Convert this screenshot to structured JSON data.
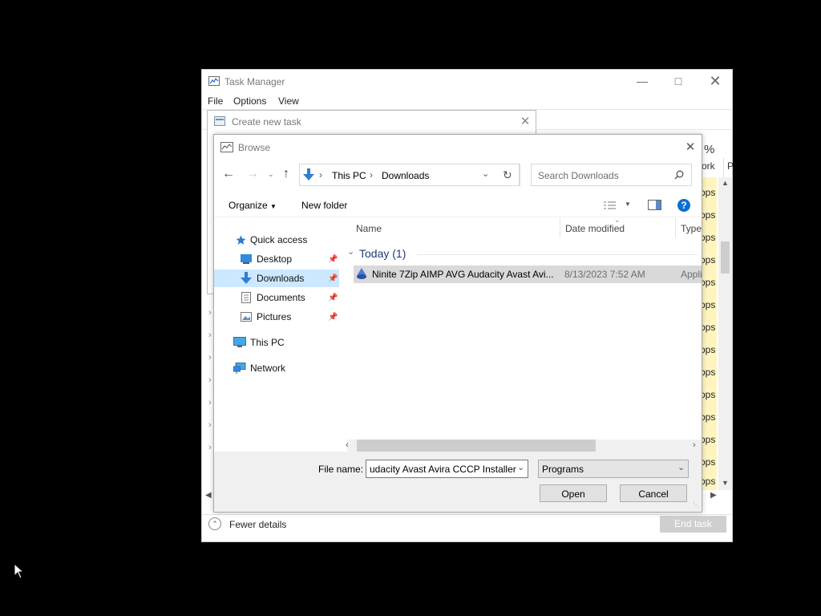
{
  "task_manager": {
    "title": "Task Manager",
    "menu": [
      "File",
      "Options",
      "View"
    ],
    "col_percent": "%",
    "col_ork": "ork",
    "col_p": "P",
    "ops_values": [
      "ops",
      "ops",
      "ops",
      "ops",
      "ops",
      "ops",
      "ops",
      "ops",
      "ops",
      "ops",
      "ops",
      "ops",
      "ops",
      "ops"
    ],
    "fewer_details": "Fewer details",
    "end_task": "End task"
  },
  "create_new_task": {
    "title": "Create new task"
  },
  "browse": {
    "title": "Browse",
    "breadcrumb": [
      "This PC",
      "Downloads"
    ],
    "search_placeholder": "Search Downloads",
    "organize": "Organize",
    "new_folder": "New folder",
    "nav": {
      "quick_access": "Quick access",
      "items": [
        "Desktop",
        "Downloads",
        "Documents",
        "Pictures"
      ],
      "this_pc": "This PC",
      "network": "Network"
    },
    "columns": {
      "name": "Name",
      "date_modified": "Date modified",
      "type": "Type"
    },
    "group": "Today (1)",
    "files": [
      {
        "name": "Ninite 7Zip AIMP AVG Audacity Avast Avi...",
        "date": "8/13/2023 7:52 AM",
        "type": "Appli"
      }
    ],
    "file_name_label": "File name:",
    "file_name_value": "udacity Avast Avira CCCP Installer",
    "file_type_value": "Programs",
    "open": "Open",
    "cancel": "Cancel"
  },
  "colors": {
    "selection": "#cce8ff",
    "file_selected": "#d9d9d9",
    "accent": "#0078d7"
  }
}
